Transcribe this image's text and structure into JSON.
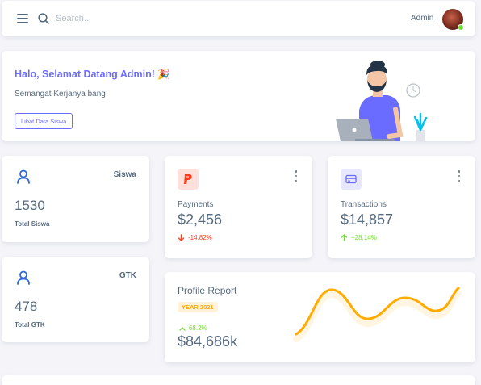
{
  "navbar": {
    "search_placeholder": "Search...",
    "user_name": "Admin",
    "icons": [
      "menu-icon",
      "search-icon"
    ],
    "online_color": "#71dd37"
  },
  "welcome": {
    "title": "Halo, Selamat Datang Admin! 🎉",
    "subtitle": "Semangat Kerjanya bang",
    "button_label": "Lihat Data Siswa",
    "accent_color": "#696cff"
  },
  "stats": {
    "siswa": {
      "label": "Siswa",
      "value": "1530",
      "caption": "Total Siswa",
      "icon": "user-icon"
    },
    "gtk": {
      "label": "GTK",
      "value": "478",
      "caption": "Total GTK",
      "icon": "user-icon"
    }
  },
  "payments": {
    "label": "Payments",
    "value": "$2,456",
    "change": "-14.82%",
    "change_direction": "down",
    "icon": "paypal-icon",
    "color": "#ff3e1d"
  },
  "transactions": {
    "label": "Transactions",
    "value": "$14,857",
    "change": "+28.14%",
    "change_direction": "up",
    "icon": "credit-card-icon",
    "color": "#71dd37"
  },
  "profile_report": {
    "title": "Profile Report",
    "year_badge": "YEAR 2021",
    "change": "68.2%",
    "value": "$84,686k",
    "line_color": "#ffab00"
  }
}
